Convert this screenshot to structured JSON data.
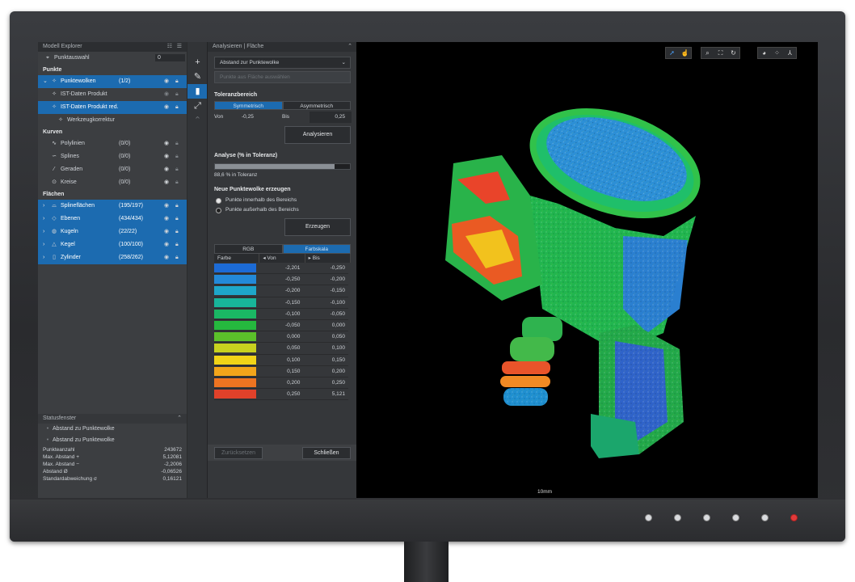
{
  "left": {
    "title": "Modell Explorer",
    "point_select": {
      "label": "Punktauswahl",
      "value": "0"
    },
    "sections": {
      "punkte": "Punkte",
      "kurven": "Kurven",
      "flaechen": "Flächen"
    },
    "punkte_items": [
      {
        "label": "Punktewolken",
        "count": "(1/2)"
      },
      {
        "label": "IST-Daten Produkt",
        "count": ""
      },
      {
        "label": "IST-Daten Produkt red.",
        "count": ""
      },
      {
        "label": "Werkzeugkorrektur",
        "count": ""
      }
    ],
    "kurven_items": [
      {
        "label": "Polylinien",
        "count": "(0/0)"
      },
      {
        "label": "Splines",
        "count": "(0/0)"
      },
      {
        "label": "Geraden",
        "count": "(0/0)"
      },
      {
        "label": "Kreise",
        "count": "(0/0)"
      }
    ],
    "flaechen_items": [
      {
        "label": "Splineflächen",
        "count": "(195/197)"
      },
      {
        "label": "Ebenen",
        "count": "(434/434)"
      },
      {
        "label": "Kugeln",
        "count": "(22/22)"
      },
      {
        "label": "Kegel",
        "count": "(100/100)"
      },
      {
        "label": "Zylinder",
        "count": "(258/262)"
      }
    ],
    "status": {
      "title": "Statusfenster",
      "entries": [
        "Abstand zu Punktewolke",
        "Abstand zu Punktewolke"
      ],
      "stats": [
        {
          "k": "Punkteanzahl",
          "v": "243672"
        },
        {
          "k": "Max. Abstand +",
          "v": "5,12081"
        },
        {
          "k": "Max. Abstand −",
          "v": "-2,2006"
        },
        {
          "k": "Abstand Ø",
          "v": "-0,06526"
        },
        {
          "k": "Standardabweichung σ",
          "v": "0,16121"
        }
      ]
    }
  },
  "mid": {
    "title": "Analysieren | Fläche",
    "dropdown": "Abstand zur Punktewolke",
    "dropdown2": "Punkte aus Fläche auswählen",
    "tolerance": {
      "title": "Toleranzbereich",
      "sym": "Symmetrisch",
      "asym": "Asymmetrisch",
      "from_label": "Von",
      "from_value": "-0,25",
      "to_label": "Bis",
      "to_value": "0,25",
      "analyze_button": "Analysieren"
    },
    "analysis": {
      "title": "Analyse (% in Toleranz)",
      "progress": 0.886,
      "result": "88,6 % in Toleranz"
    },
    "new_cloud": {
      "title": "Neue Punktewolke erzeugen",
      "option_in": "Punkte innerhalb des Bereichs",
      "option_out": "Punkte außerhalb des Bereichs",
      "button": "Erzeugen"
    },
    "colorscale": {
      "tab_rgb": "RGB",
      "tab_scale": "Farbskala",
      "col_color": "Farbe",
      "col_from": "Von",
      "col_to": "Bis",
      "rows": [
        {
          "color": "#1c6bd6",
          "from": "-2,201",
          "to": "-0,250"
        },
        {
          "color": "#2389d8",
          "from": "-0,250",
          "to": "-0,200"
        },
        {
          "color": "#1ea7c9",
          "from": "-0,200",
          "to": "-0,150"
        },
        {
          "color": "#18b59a",
          "from": "-0,150",
          "to": "-0,100"
        },
        {
          "color": "#1ab864",
          "from": "-0,100",
          "to": "-0,050"
        },
        {
          "color": "#25b83e",
          "from": "-0,050",
          "to": "0,000"
        },
        {
          "color": "#5bc02a",
          "from": "0,000",
          "to": "0,050"
        },
        {
          "color": "#c7d11f",
          "from": "0,050",
          "to": "0,100"
        },
        {
          "color": "#f1d417",
          "from": "0,100",
          "to": "0,150"
        },
        {
          "color": "#f3a51a",
          "from": "0,150",
          "to": "0,200"
        },
        {
          "color": "#ee7421",
          "from": "0,200",
          "to": "0,250"
        },
        {
          "color": "#e0412a",
          "from": "0,250",
          "to": "5,121"
        }
      ]
    },
    "reset_button": "Zurücksetzen",
    "close_button": "Schließen"
  },
  "viewport": {
    "scale_label": "10mm"
  }
}
